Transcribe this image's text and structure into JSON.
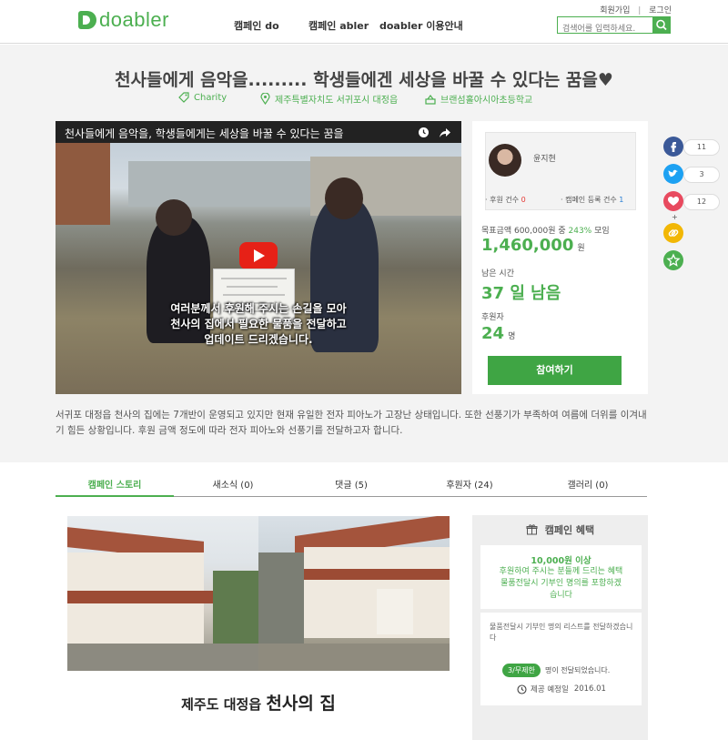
{
  "header": {
    "brand": "doabler",
    "nav": [
      "캠페인 do",
      "캠페인 abler",
      "doabler 이용안내"
    ],
    "signup": "회원가입",
    "sep": "|",
    "login": "로그인",
    "search_placeholder": "검색어를 입력하세요."
  },
  "campaign": {
    "title": "천사들에게 음악을......... 학생들에겐 세상을 바꿀 수 있다는 꿈을♥",
    "category": "Charity",
    "location": "제주특별자치도 서귀포시 대정읍",
    "organization": "브랜섬홀아시아초등학교",
    "video_title": "천사들에게 음악을, 학생들에게는 세상을 바꿀 수 있다는 꿈을",
    "video_subtitle": [
      "여러분께서 후원해 주시는 손길을 모아",
      "천사의 집에서 필요한 물품을 전달하고",
      "업데이트 드리겠습니다."
    ],
    "description": "서귀포 대정읍 천사의 집에는 7개반이 운영되고 있지만 현재 유일한 전자 피아노가 고장난 상태입니다. 또한 선풍기가 부족하여 여름에 더위를 이겨내기 힘든 상황입니다. 후원 금액 정도에 따라 전자 피아노와 선풍기를 전달하고자 합니다."
  },
  "profile": {
    "name": "윤지현",
    "sponsor_label": "· 후원 건수",
    "sponsor_count": "0",
    "register_label": "· 캠페인 등록 건수",
    "register_count": "1"
  },
  "stats": {
    "goal_prefix": "목표금액 600,000원 중",
    "goal_percent": "243%",
    "goal_suffix": "모임",
    "amount": "1,460,000",
    "amount_unit": "원",
    "remaining_label": "남은 시간",
    "remaining": "37 일 남음",
    "backers_label": "후원자",
    "backers": "24",
    "backers_unit": "명",
    "join_button": "참여하기"
  },
  "social": {
    "facebook": "11",
    "twitter": "3",
    "like": "12",
    "plus": "+"
  },
  "tabs": [
    "캠페인 스토리",
    "새소식 (0)",
    "댓글 (5)",
    "후원자 (24)",
    "갤러리 (0)"
  ],
  "story": {
    "caption_prefix": "제주도 대정읍",
    "caption_emphasis": "천사의 집"
  },
  "reward": {
    "header": "캠페인 혜택",
    "title": "10,000원 이상",
    "text": [
      "후원하여 주시는 분들께 드리는 혜택",
      "물품전달시 기부인 명의를 포함하겠",
      "습니다"
    ],
    "note": "물품전달시 기부인 명의 리스트를 전달하겠습니다",
    "badge": "3/무제한",
    "badge_text": "명이 전달되었습니다.",
    "delivery_label": "제공 예정일",
    "delivery_date": "2016.01"
  },
  "colors": {
    "brand": "#4caf50",
    "button": "#3fa544",
    "facebook": "#3b5998",
    "twitter": "#1da1f2",
    "like": "#e84a5f",
    "link": "#f2b705",
    "favorite": "#4caf50"
  }
}
